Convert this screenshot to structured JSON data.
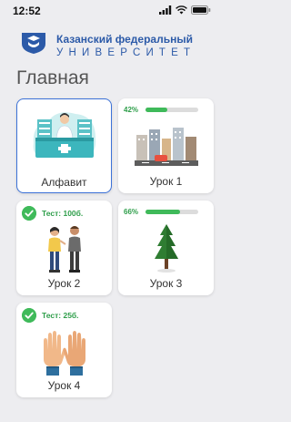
{
  "status_bar": {
    "time": "12:52"
  },
  "header": {
    "university_name": "Казанский федеральный",
    "university_sub": "УНИВЕРСИТЕТ"
  },
  "page": {
    "title": "Главная"
  },
  "cards": [
    {
      "label": "Алфавит",
      "illustration": "pharmacy-counter-illustration",
      "selected": true
    },
    {
      "label": "Урок 1",
      "progress_text": "42%",
      "progress": 0.42,
      "illustration": "city-street-illustration"
    },
    {
      "label": "Урок 2",
      "test_text": "Тест: 100б.",
      "illustration": "two-people-talking-illustration"
    },
    {
      "label": "Урок 3",
      "progress_text": "66%",
      "progress": 0.66,
      "illustration": "pine-tree-illustration"
    },
    {
      "label": "Урок 4",
      "test_text": "Тест: 25б.",
      "illustration": "raised-hands-illustration"
    }
  ],
  "colors": {
    "accent": "#3c72d8",
    "progress": "#3fba5a",
    "brand": "#2c5aa8"
  }
}
